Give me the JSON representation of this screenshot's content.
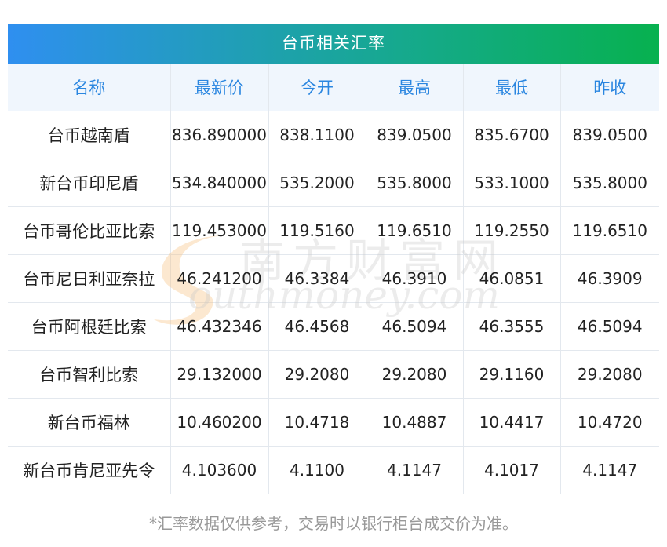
{
  "title": "台币相关汇率",
  "headers": [
    "名称",
    "最新价",
    "今开",
    "最高",
    "最低",
    "昨收"
  ],
  "rows": [
    [
      "台币越南盾",
      "836.890000",
      "838.1100",
      "839.0500",
      "835.6700",
      "839.0500"
    ],
    [
      "新台币印尼盾",
      "534.840000",
      "535.2000",
      "535.8000",
      "533.1000",
      "535.8000"
    ],
    [
      "台币哥伦比亚比索",
      "119.453000",
      "119.5160",
      "119.6510",
      "119.2550",
      "119.6510"
    ],
    [
      "台币尼日利亚奈拉",
      "46.241200",
      "46.3384",
      "46.3910",
      "46.0851",
      "46.3909"
    ],
    [
      "台币阿根廷比索",
      "46.432346",
      "46.4568",
      "46.5094",
      "46.3555",
      "46.5094"
    ],
    [
      "台币智利比索",
      "29.132000",
      "29.2080",
      "29.2080",
      "29.1160",
      "29.2080"
    ],
    [
      "新台币福林",
      "10.460200",
      "10.4718",
      "10.4887",
      "10.4417",
      "10.4720"
    ],
    [
      "新台币肯尼亚先令",
      "4.103600",
      "4.1100",
      "4.1147",
      "4.1017",
      "4.1147"
    ]
  ],
  "watermark": {
    "cn": "南方财富网",
    "en": "outhmoney.com"
  },
  "footnote": "*汇率数据仅供参考，交易时以银行柜台成交价为准。",
  "colors": {
    "header_gradient_start": "#2f8ff0",
    "header_gradient_end": "#07b14f",
    "column_header_text": "#2a86e0",
    "column_header_bg": "#f0f6fd",
    "cell_text": "#222222",
    "footnote_text": "#999999"
  }
}
